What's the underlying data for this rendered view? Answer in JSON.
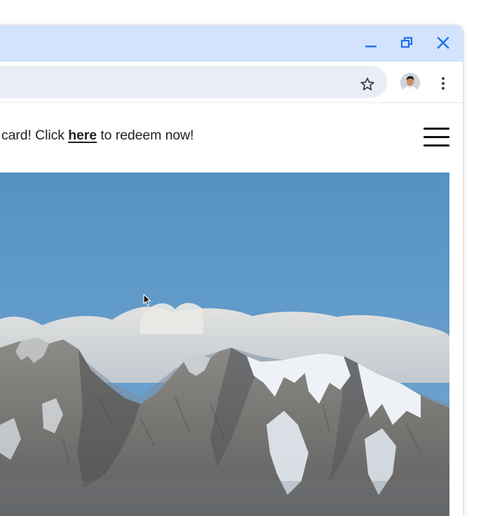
{
  "window_controls": {
    "minimize_icon": "minimize-icon",
    "restore_icon": "restore-icon",
    "close_icon": "close-icon",
    "icon_color": "#1a73e8"
  },
  "toolbar": {
    "bookmark_icon": "star-icon",
    "profile_icon": "avatar",
    "menu_icon": "more-vert-icon"
  },
  "page": {
    "banner_prefix": "card! Click ",
    "banner_link": "here",
    "banner_suffix": " to redeem now!",
    "menu_icon": "hamburger-menu-icon"
  },
  "hero_image": {
    "subject": "snow-capped mountain range under blue sky"
  },
  "colors": {
    "titlebar": "#d3e3fd",
    "omnibox": "#e9eef6",
    "sky": "#5b97c6"
  }
}
